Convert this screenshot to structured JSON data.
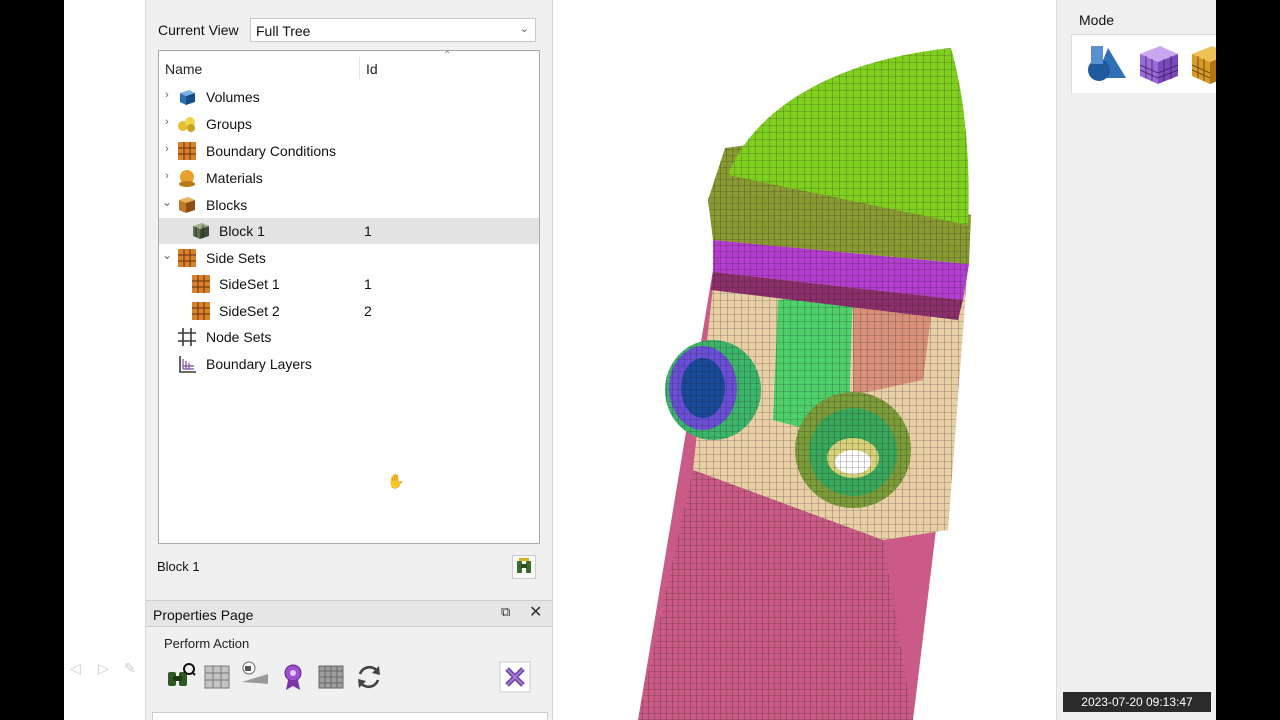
{
  "tree_panel": {
    "current_view_label": "Current View",
    "current_view_value": "Full Tree",
    "columns": {
      "name": "Name",
      "id": "Id"
    },
    "rows": [
      {
        "label": "Volumes",
        "id": ""
      },
      {
        "label": "Groups",
        "id": ""
      },
      {
        "label": "Boundary Conditions",
        "id": ""
      },
      {
        "label": "Materials",
        "id": ""
      },
      {
        "label": "Blocks",
        "id": ""
      },
      {
        "label": "Block 1",
        "id": "1"
      },
      {
        "label": "Side Sets",
        "id": ""
      },
      {
        "label": "SideSet 1",
        "id": "1"
      },
      {
        "label": "SideSet 2",
        "id": "2"
      },
      {
        "label": "Node Sets",
        "id": ""
      },
      {
        "label": "Boundary Layers",
        "id": ""
      }
    ],
    "selected_label": "Block 1"
  },
  "properties": {
    "title": "Properties Page",
    "section_label": "Perform Action"
  },
  "mode_panel": {
    "label": "Mode"
  },
  "timestamp": "2023-07-20 09:13:47",
  "colors": {
    "mesh_dome": "#7fcf1f",
    "mesh_body": "#c95b86",
    "mesh_band": "#b43ccf",
    "mesh_tan": "#e8cfa6",
    "selection_row": "#e3e3e3"
  }
}
